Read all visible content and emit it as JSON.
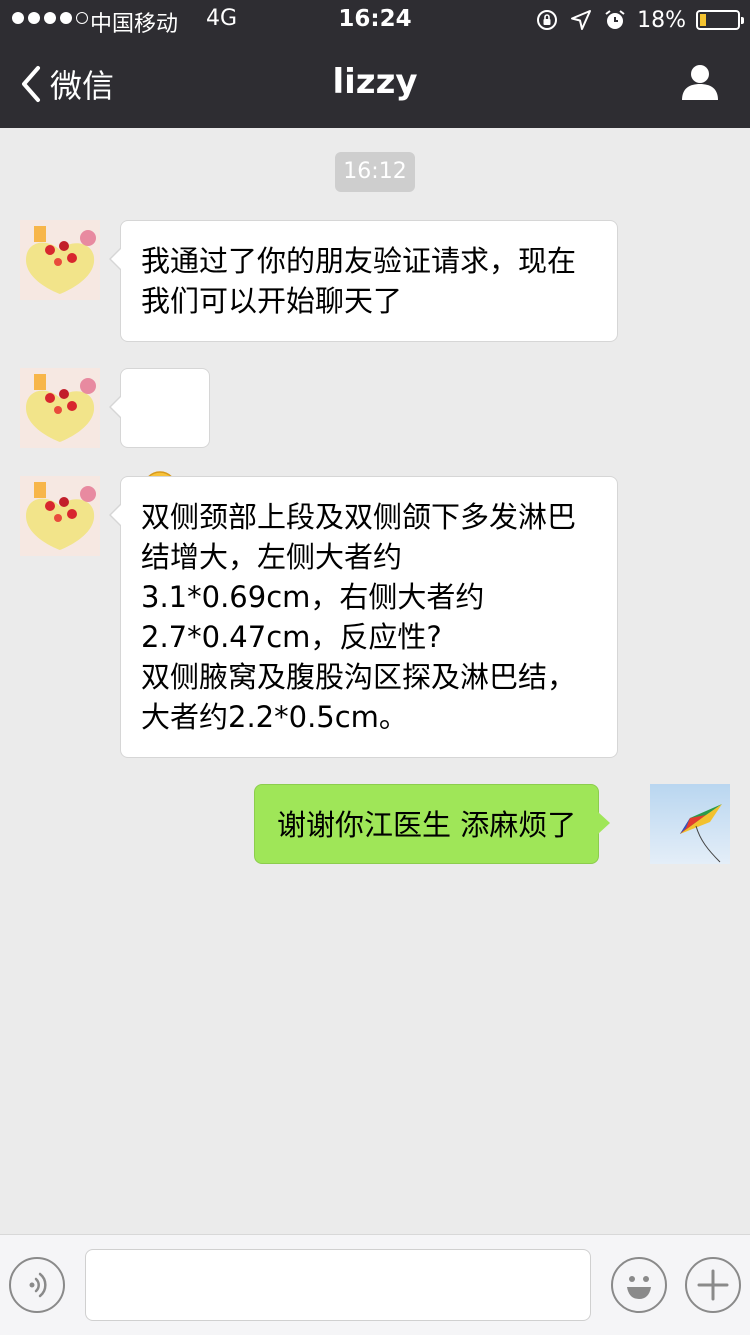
{
  "status_bar": {
    "carrier": "中国移动",
    "network": "4G",
    "time": "16:24",
    "battery_percent": "18%",
    "battery_level": 0.18
  },
  "nav": {
    "back_label": "微信",
    "title": "lizzy"
  },
  "chat": {
    "timestamp": "16:12",
    "messages": [
      {
        "side": "incoming",
        "text": "我通过了你的朋友验证请求，现在我们可以开始聊天了"
      },
      {
        "side": "incoming",
        "emoji": "grinning-face"
      },
      {
        "side": "incoming",
        "text": "双侧颈部上段及双侧颌下多发淋巴结增大，左侧大者约3.1*0.69cm，右侧大者约2.7*0.47cm，反应性?\n双侧腋窝及腹股沟区探及淋巴结，大者约2.2*0.5cm。"
      },
      {
        "side": "outgoing",
        "text": "谢谢你江医生 添麻烦了"
      }
    ]
  },
  "input_bar": {
    "value": ""
  },
  "colors": {
    "nav_background": "#2e2d32",
    "chat_background": "#ebebeb",
    "outgoing_bubble": "#9fe658",
    "incoming_bubble": "#ffffff",
    "battery_fill": "#f5c431"
  },
  "icons": {
    "signal": "signal-dots",
    "rotation_lock": "rotation-lock-icon",
    "location": "location-arrow-icon",
    "alarm": "alarm-clock-icon",
    "back": "chevron-left-icon",
    "profile": "person-icon",
    "voice": "voice-icon",
    "emoji": "smiley-icon",
    "plus": "plus-icon"
  }
}
